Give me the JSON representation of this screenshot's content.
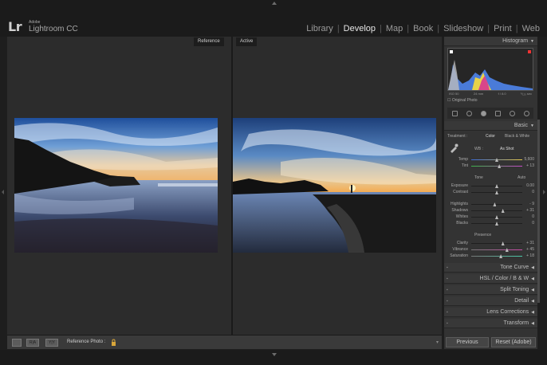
{
  "app": {
    "brand_small": "Adobe",
    "brand_name": "Lightroom CC",
    "logo": "Lr"
  },
  "modules": [
    {
      "label": "Library",
      "active": false
    },
    {
      "label": "Develop",
      "active": true
    },
    {
      "label": "Map",
      "active": false
    },
    {
      "label": "Book",
      "active": false
    },
    {
      "label": "Slideshow",
      "active": false
    },
    {
      "label": "Print",
      "active": false
    },
    {
      "label": "Web",
      "active": false
    }
  ],
  "compare": {
    "reference_label": "Reference",
    "active_label": "Active"
  },
  "toolbar": {
    "reference_photo_label": "Reference Photo :",
    "view_icons": [
      "loupe-view-icon",
      "ref-view-icon",
      "compare-view-icon"
    ]
  },
  "panel": {
    "histogram_title": "Histogram",
    "histo_info": [
      "ISO 50",
      "24 mm",
      "f / 8.0",
      "¹⁄₁₂₅ sec"
    ],
    "original_photo_label": "Original Photo",
    "basic_title": "Basic",
    "treatment_label": "Treatment :",
    "treatment_color": "Color",
    "treatment_bw": "Black & White",
    "wb_label": "WB :",
    "wb_value": "As Shot",
    "temp": {
      "label": "Temp",
      "value": "5,600",
      "level": 0.5
    },
    "tint": {
      "label": "Tint",
      "value": "+ 13",
      "level": 0.55
    },
    "tone_label": "Tone",
    "auto_label": "Auto",
    "exposure": {
      "label": "Exposure",
      "value": "0.00",
      "level": 0.5
    },
    "contrast": {
      "label": "Contrast",
      "value": "0",
      "level": 0.5
    },
    "highlights": {
      "label": "Highlights",
      "value": "- 9",
      "level": 0.46
    },
    "shadows": {
      "label": "Shadows",
      "value": "+ 31",
      "level": 0.62
    },
    "whites": {
      "label": "Whites",
      "value": "0",
      "level": 0.5
    },
    "blacks": {
      "label": "Blacks",
      "value": "0",
      "level": 0.5
    },
    "presence_label": "Presence",
    "clarity": {
      "label": "Clarity",
      "value": "+ 31",
      "level": 0.62
    },
    "vibrance": {
      "label": "Vibrance",
      "value": "+ 45",
      "level": 0.7
    },
    "saturation": {
      "label": "Saturation",
      "value": "+ 18",
      "level": 0.58
    },
    "sections": [
      {
        "label": "Tone Curve"
      },
      {
        "label": "HSL / Color / B & W"
      },
      {
        "label": "Split Toning"
      },
      {
        "label": "Detail"
      },
      {
        "label": "Lens Corrections"
      },
      {
        "label": "Transform"
      }
    ],
    "previous_label": "Previous",
    "reset_label": "Reset (Adobe)"
  }
}
